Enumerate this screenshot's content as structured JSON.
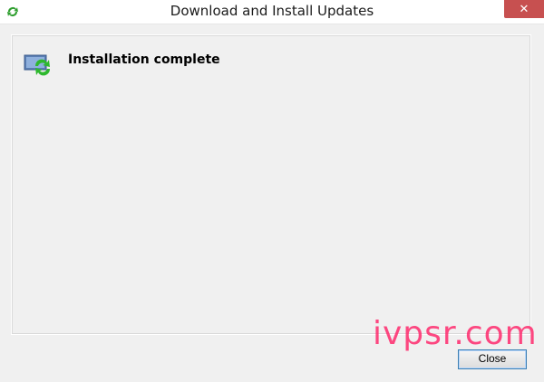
{
  "window": {
    "title": "Download and Install Updates",
    "close_glyph": "✕"
  },
  "content": {
    "status_text": "Installation complete",
    "status_icon": "update-refresh-icon"
  },
  "watermark": {
    "text": "ivpsr.com",
    "color": "#ff2a6d"
  },
  "footer": {
    "close_label": "Close"
  },
  "colors": {
    "accent_green": "#2e9e2e",
    "close_x_bg": "#c75050",
    "button_border": "#3c7fb1"
  }
}
